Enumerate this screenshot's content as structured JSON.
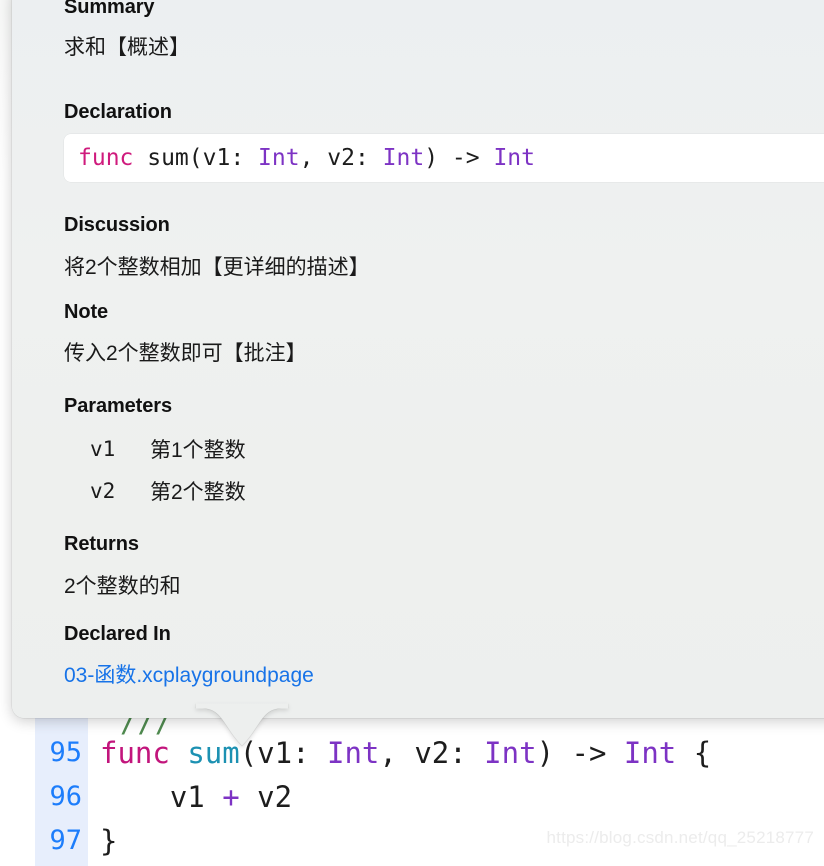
{
  "editor": {
    "comment_sliver": "///",
    "lines": [
      {
        "number": "95",
        "tokens": [
          {
            "text": "func",
            "kind": "kw"
          },
          {
            "text": " ",
            "kind": "plain"
          },
          {
            "text": "sum",
            "kind": "fnname"
          },
          {
            "text": "(v1: ",
            "kind": "plain"
          },
          {
            "text": "Int",
            "kind": "type"
          },
          {
            "text": ", v2: ",
            "kind": "plain"
          },
          {
            "text": "Int",
            "kind": "type"
          },
          {
            "text": ") ",
            "kind": "plain"
          },
          {
            "text": "->",
            "kind": "plain"
          },
          {
            "text": " ",
            "kind": "plain"
          },
          {
            "text": "Int",
            "kind": "type"
          },
          {
            "text": " {",
            "kind": "plain"
          }
        ]
      },
      {
        "number": "96",
        "tokens": [
          {
            "text": "    v1 ",
            "kind": "plain"
          },
          {
            "text": "+",
            "kind": "op"
          },
          {
            "text": " v2",
            "kind": "plain"
          }
        ]
      },
      {
        "number": "97",
        "tokens": [
          {
            "text": "}",
            "kind": "plain"
          }
        ]
      }
    ]
  },
  "watermark": {
    "text": "https://blog.csdn.net/qq_25218777"
  },
  "quick_help": {
    "summary": {
      "heading": "Summary",
      "text": "求和【概述】"
    },
    "declaration": {
      "heading": "Declaration",
      "tokens": [
        {
          "text": "func",
          "kind": "kw"
        },
        {
          "text": " sum(v1: ",
          "kind": "plain"
        },
        {
          "text": "Int",
          "kind": "type"
        },
        {
          "text": ", v2: ",
          "kind": "plain"
        },
        {
          "text": "Int",
          "kind": "type"
        },
        {
          "text": ") -> ",
          "kind": "plain"
        },
        {
          "text": "Int",
          "kind": "type"
        }
      ],
      "full_text": "func sum(v1: Int, v2: Int) -> Int"
    },
    "discussion": {
      "heading": "Discussion",
      "text": "将2个整数相加【更详细的描述】"
    },
    "note": {
      "heading": "Note",
      "text": "传入2个整数即可【批注】"
    },
    "parameters": {
      "heading": "Parameters",
      "items": [
        {
          "name": "v1",
          "description": "第1个整数"
        },
        {
          "name": "v2",
          "description": "第2个整数"
        }
      ]
    },
    "returns": {
      "heading": "Returns",
      "text": "2个整数的和"
    },
    "declared_in": {
      "heading": "Declared In",
      "link_text": "03-函数.xcplaygroundpage"
    }
  },
  "colors": {
    "popover_bg": "#eff1f0",
    "declaration_box_bg": "#ffffff",
    "keyword": "#cf1b7d",
    "type": "#7d33c4",
    "function_name": "#1c91b2",
    "comment": "#4f8a4f",
    "link": "#1773e8",
    "line_number": "#1d7dfb",
    "gutter_bg": "#e7eefc",
    "watermark": "#ececec"
  }
}
